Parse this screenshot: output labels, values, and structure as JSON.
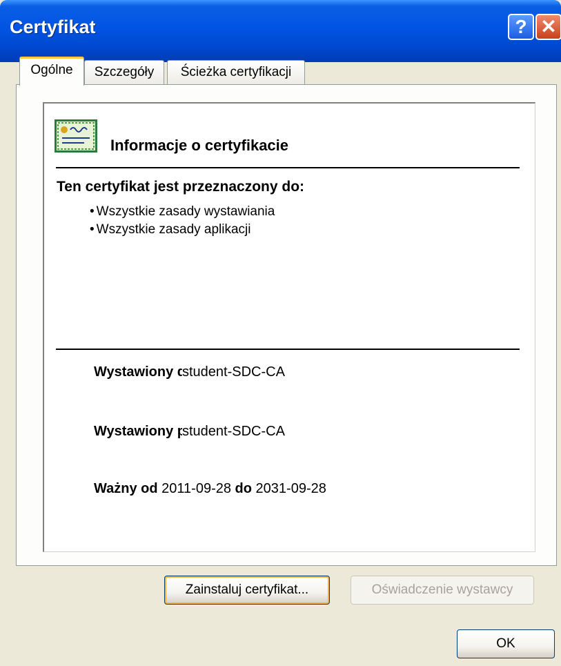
{
  "window": {
    "title": "Certyfikat"
  },
  "titlebar": {
    "help_glyph": "?",
    "close_glyph": "✕"
  },
  "tabs": [
    {
      "label": "Ogólne",
      "active": true
    },
    {
      "label": "Szczegóły",
      "active": false
    },
    {
      "label": "Ścieżka certyfikacji",
      "active": false
    }
  ],
  "general": {
    "icon": "certificate-icon",
    "info_title": "Informacje o certyfikacie",
    "purpose_heading": "Ten certyfikat jest przeznaczony do:",
    "purposes": [
      "Wszystkie zasady wystawiania",
      "Wszystkie zasady aplikacji"
    ],
    "issued_to_label": "Wystawiony dla:",
    "issued_to_value": "student-SDC-CA",
    "issued_by_label": "Wystawiony przez:",
    "issued_by_value": "student-SDC-CA",
    "valid_from_label": "Ważny od",
    "valid_from": "2011-09-28",
    "valid_to_label": "do",
    "valid_to": "2031-09-28"
  },
  "buttons": {
    "install": "Zainstaluj certyfikat...",
    "issuer_statement": "Oświadczenie wystawcy",
    "ok": "OK"
  },
  "colors": {
    "titlebar": "#0054e3",
    "face": "#ece9d8",
    "tab_highlight": "#ffc83c"
  }
}
